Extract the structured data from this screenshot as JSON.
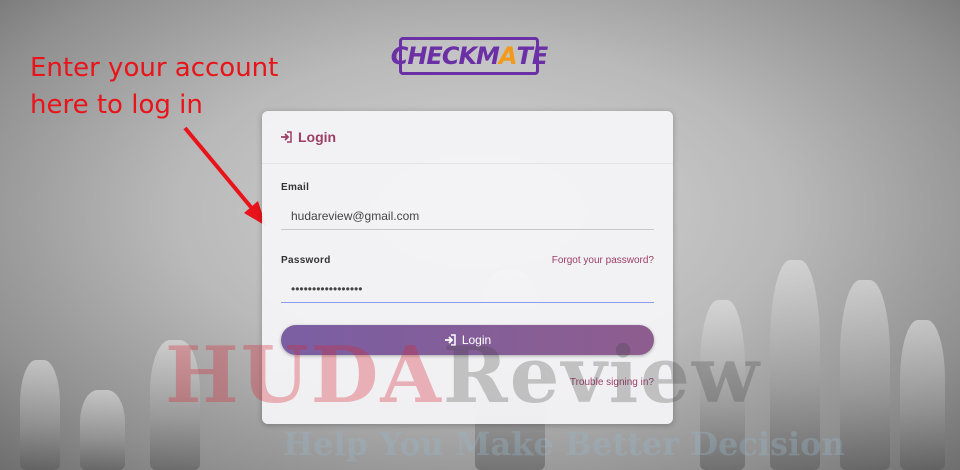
{
  "logo": {
    "text_start": "CHECKM",
    "text_accent": "A",
    "text_end": "TE",
    "colors": {
      "border": "#6b2fa6",
      "accent": "#f29a1a"
    }
  },
  "annotation": {
    "line1": "Enter your account",
    "line2": "here to log in",
    "color": "#e8141a"
  },
  "login_card": {
    "title": "Login",
    "title_icon": "sign-in-icon",
    "email_label": "Email",
    "email_value": "hudareview@gmail.com",
    "password_label": "Password",
    "password_value": "•••••••••••••••••",
    "forgot_link": "Forgot your password?",
    "login_button": "Login",
    "trouble_link": "Trouble signing in?",
    "accent_color": "#9c3f66"
  },
  "watermark": {
    "word1": "HUDA",
    "word2": "Review",
    "tagline": "Help You Make Better Decision"
  }
}
